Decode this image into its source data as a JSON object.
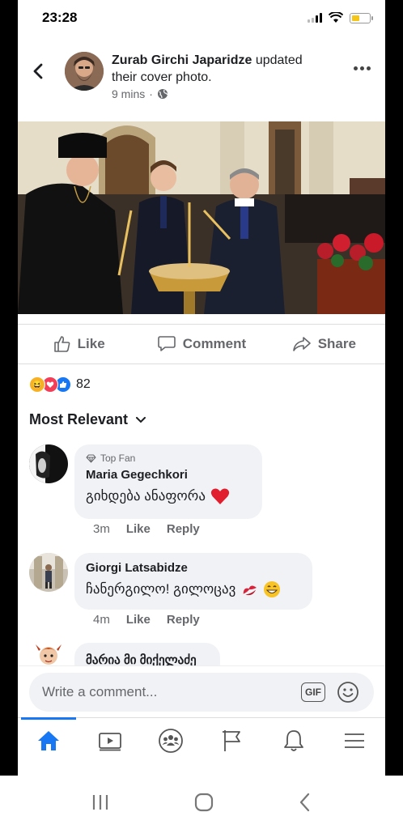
{
  "status": {
    "time": "23:28"
  },
  "post": {
    "author": "Zurab Girchi Japaridze",
    "action_text": " updated their cover photo.",
    "time": "9 mins",
    "separator": "·"
  },
  "actions": {
    "like": "Like",
    "comment": "Comment",
    "share": "Share"
  },
  "reactions": {
    "count": "82"
  },
  "sort": {
    "label": "Most Relevant"
  },
  "comments": [
    {
      "badge": "Top Fan",
      "name": "Maria Gegechkori",
      "text": "გიხდება ანაფორა",
      "time": "3m",
      "like": "Like",
      "reply": "Reply"
    },
    {
      "name": "Giorgi Latsabidze",
      "text": "ჩანერგილო! გილოცავ",
      "time": "4m",
      "like": "Like",
      "reply": "Reply"
    },
    {
      "name": "მარია მი მიქელაძე"
    }
  ],
  "composer": {
    "placeholder": "Write a comment...",
    "gif": "GIF"
  },
  "colors": {
    "accent": "#1877f2",
    "heart": "#e0245e"
  }
}
